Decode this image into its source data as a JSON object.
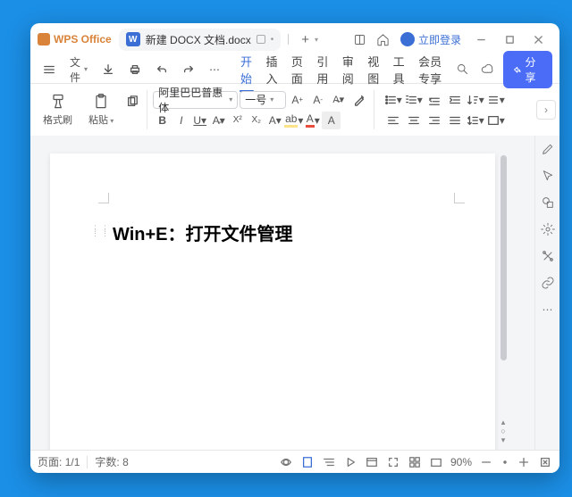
{
  "app": {
    "name": "WPS Office"
  },
  "tab": {
    "title": "新建 DOCX 文档.docx"
  },
  "login": {
    "label": "立即登录"
  },
  "menu": {
    "file": "文件",
    "tabs": [
      "开始",
      "插入",
      "页面",
      "引用",
      "审阅",
      "视图",
      "工具",
      "会员专享"
    ],
    "active_index": 0
  },
  "share": {
    "label": "分享"
  },
  "toolbar": {
    "format_painter": "格式刷",
    "paste": "粘贴",
    "font_name": "阿里巴巴普惠体",
    "font_size": "一号"
  },
  "document": {
    "content": "Win+E：打开文件管理"
  },
  "status": {
    "page_label": "页面:",
    "page_value": "1/1",
    "wordcount_label": "字数:",
    "wordcount_value": "8",
    "zoom": "90%"
  }
}
